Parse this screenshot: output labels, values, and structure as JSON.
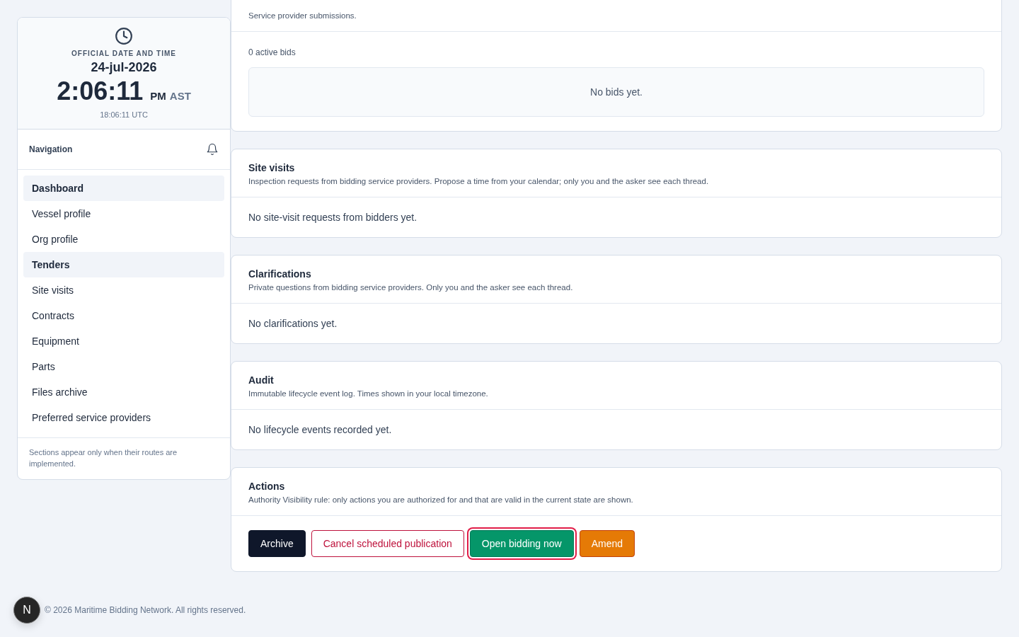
{
  "clock": {
    "label": "OFFICIAL DATE AND TIME",
    "date": "24-jul-2026",
    "time": "2:06:11",
    "meridiem": "PM",
    "zone": "AST",
    "utc": "18:06:11 UTC"
  },
  "navigation": {
    "title": "Navigation",
    "items": [
      {
        "label": "Dashboard",
        "selected": true
      },
      {
        "label": "Vessel profile",
        "selected": false
      },
      {
        "label": "Org profile",
        "selected": false
      },
      {
        "label": "Tenders",
        "selected": true
      },
      {
        "label": "Site visits",
        "selected": false
      },
      {
        "label": "Contracts",
        "selected": false
      },
      {
        "label": "Equipment",
        "selected": false
      },
      {
        "label": "Parts",
        "selected": false
      },
      {
        "label": "Files archive",
        "selected": false
      },
      {
        "label": "Preferred service providers",
        "selected": false
      }
    ],
    "note": "Sections appear only when their routes are implemented."
  },
  "bids": {
    "description": "Service provider submissions.",
    "count": "0 active bids",
    "empty": "No bids yet."
  },
  "sections": [
    {
      "title": "Site visits",
      "description": "Inspection requests from bidding service providers. Propose a time from your calendar; only you and the asker see each thread.",
      "empty": "No site-visit requests from bidders yet."
    },
    {
      "title": "Clarifications",
      "description": "Private questions from bidding service providers. Only you and the asker see each thread.",
      "empty": "No clarifications yet."
    },
    {
      "title": "Audit",
      "description": "Immutable lifecycle event log. Times shown in your local timezone.",
      "empty": "No lifecycle events recorded yet."
    }
  ],
  "actions": {
    "title": "Actions",
    "description": "Authority Visibility rule: only actions you are authorized for and that are valid in the current state are shown.",
    "buttons": [
      {
        "label": "Archive",
        "kind": "primary",
        "focused": false
      },
      {
        "label": "Cancel scheduled publication",
        "kind": "danger",
        "focused": false
      },
      {
        "label": "Open bidding now",
        "kind": "success",
        "focused": true
      },
      {
        "label": "Amend",
        "kind": "warning",
        "focused": false
      }
    ]
  },
  "footer": "© 2026 Maritime Bidding Network. All rights reserved.",
  "dev_badge": "N"
}
